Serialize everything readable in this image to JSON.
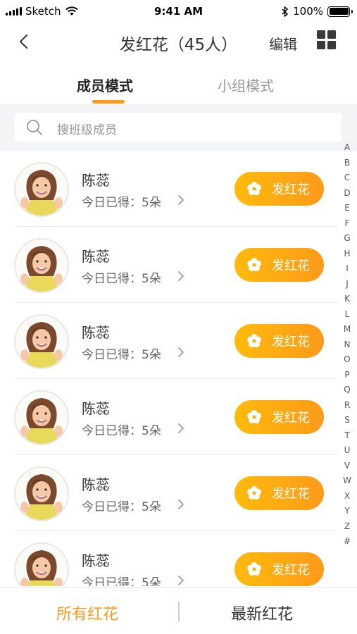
{
  "status_bar": {
    "carrier": "Sketch",
    "time": "9:41 AM",
    "battery": "100%"
  },
  "nav": {
    "title": "发红花（45人）",
    "edit_label": "编辑",
    "back_icon": "chevron-left-icon",
    "grid_icon": "grid-icon"
  },
  "tabs": [
    {
      "label": "成员模式",
      "active": true
    },
    {
      "label": "小组模式",
      "active": false
    }
  ],
  "search": {
    "placeholder": "搜班级成员"
  },
  "members": [
    {
      "name": "陈蕊",
      "today": "今日已得：5朵",
      "button_label": "发红花"
    },
    {
      "name": "陈蕊",
      "today": "今日已得：5朵",
      "button_label": "发红花"
    },
    {
      "name": "陈蕊",
      "today": "今日已得：5朵",
      "button_label": "发红花"
    },
    {
      "name": "陈蕊",
      "today": "今日已得：5朵",
      "button_label": "发红花"
    },
    {
      "name": "陈蕊",
      "today": "今日已得：5朵",
      "button_label": "发红花"
    },
    {
      "name": "陈蕊",
      "today": "今日已得：5朵",
      "button_label": "发红花"
    }
  ],
  "alpha_index": [
    "A",
    "B",
    "C",
    "D",
    "E",
    "F",
    "G",
    "H",
    "I",
    "J",
    "K",
    "L",
    "M",
    "N",
    "O",
    "P",
    "Q",
    "R",
    "S",
    "T",
    "U",
    "V",
    "W",
    "X",
    "Y",
    "Z",
    "#"
  ],
  "bottom_tabs": [
    {
      "label": "所有红花",
      "active": true
    },
    {
      "label": "最新红花",
      "active": false
    }
  ],
  "colors": {
    "accent": "#ff9a1e",
    "button_gradient_start": "#ffba0c",
    "button_gradient_end": "#ff9a1a"
  }
}
